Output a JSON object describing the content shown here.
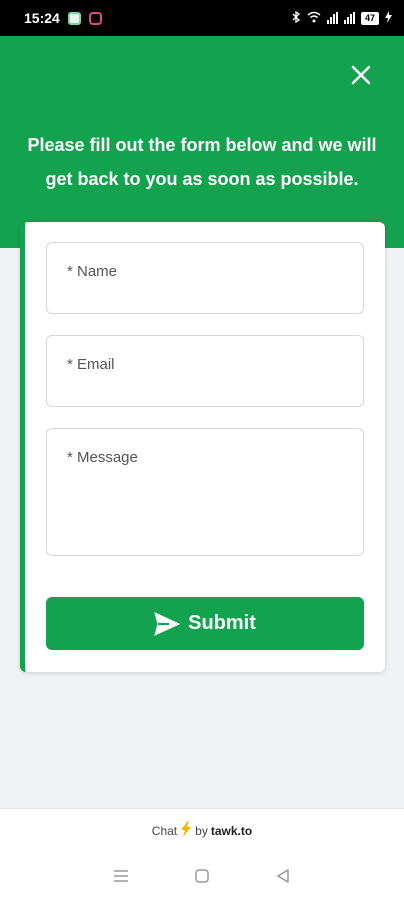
{
  "status_bar": {
    "time": "15:24",
    "battery": "47"
  },
  "header": {
    "message": "Please fill out the form below and we will get back to you as soon as possible."
  },
  "form": {
    "name_placeholder": "* Name",
    "email_placeholder": "* Email",
    "message_placeholder": "* Message",
    "submit_label": "Submit"
  },
  "footer": {
    "chat_label": "Chat",
    "by_label": "by",
    "brand": "tawk.to"
  },
  "colors": {
    "accent": "#13a24d",
    "lightning": "#f7b500"
  },
  "icons": {
    "close": "close-icon",
    "send": "send-icon",
    "lightning": "lightning-icon",
    "menu": "menu-icon",
    "home": "home-icon",
    "back": "back-icon"
  }
}
